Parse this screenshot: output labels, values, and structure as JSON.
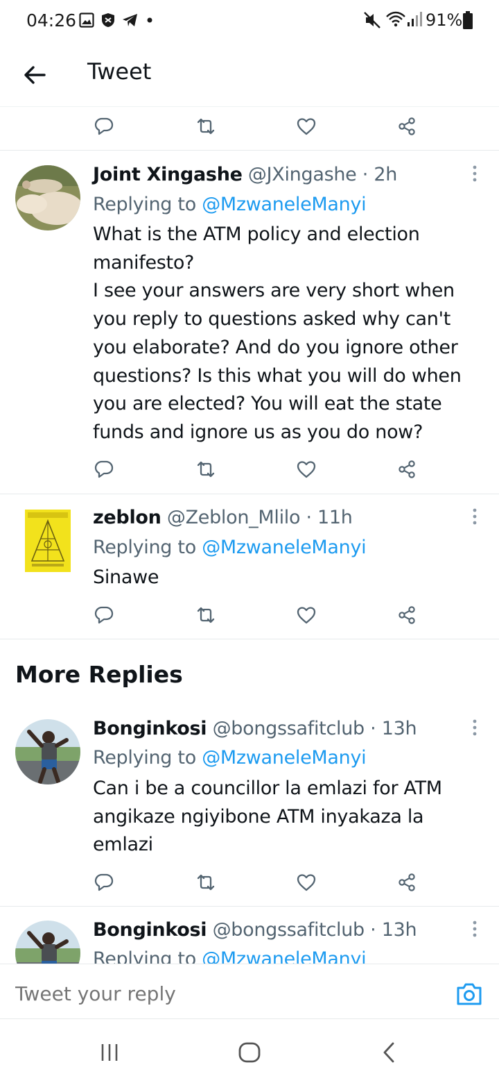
{
  "status_bar": {
    "time": "04:26",
    "battery": "91%"
  },
  "header": {
    "title": "Tweet"
  },
  "tweets": [
    {
      "name": "Joint Xingashe",
      "meta": "@JXingashe · 2h",
      "replying_prefix": "Replying to ",
      "replying_to": "@MzwaneleManyi",
      "lines": [
        "What is the ATM policy and election",
        "manifesto?",
        "I see your answers are very short when",
        "you reply to questions asked why can't",
        "you elaborate? And do you ignore other",
        "questions? Is this what you will do when",
        "you are elected? You will eat the state",
        "funds and ignore us as you do now?"
      ]
    },
    {
      "name": "zeblon",
      "meta": "@Zeblon_Mlilo · 11h",
      "replying_prefix": "Replying to ",
      "replying_to": "@MzwaneleManyi",
      "lines": [
        "Sinawe"
      ]
    },
    {
      "name": "Bonginkosi",
      "meta": "@bongssafitclub · 13h",
      "replying_prefix": "Replying to ",
      "replying_to": "@MzwaneleManyi",
      "lines": [
        "Can i be a councillor la emlazi for ATM",
        "angikaze ngiyibone ATM inyakaza la",
        "emlazi"
      ]
    },
    {
      "name": "Bonginkosi",
      "meta": "@bongssafitclub · 13h",
      "replying_prefix": "Replying to ",
      "replying_to": "@MzwaneleManyi",
      "lines": []
    }
  ],
  "more_replies_title": "More Replies",
  "reply_bar": {
    "placeholder": "Tweet your reply"
  },
  "colors": {
    "accent": "#1d9bf0",
    "text": "#0f1419",
    "secondary": "#536471",
    "divider": "#e6eaeb"
  }
}
